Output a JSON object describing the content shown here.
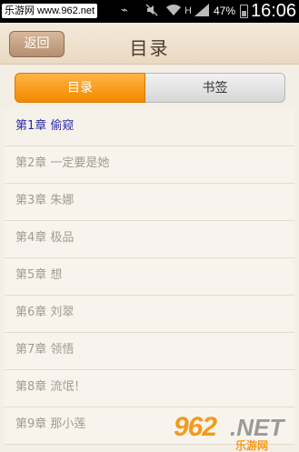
{
  "watermark_top": "乐游网 www.962.net",
  "status_bar": {
    "battery_text": "47%",
    "time": "16:06",
    "battery_level_percent": 47,
    "icons": [
      "usb-icon",
      "mute-icon",
      "wifi-icon",
      "h-signal-icon",
      "signal-bars-icon",
      "battery-icon"
    ]
  },
  "header": {
    "back_label": "返回",
    "title": "目录"
  },
  "tabs": [
    {
      "label": "目录",
      "selected": true
    },
    {
      "label": "书签",
      "selected": false
    }
  ],
  "chapters": [
    {
      "label": "第1章 偷窥",
      "active": true
    },
    {
      "label": "第2章 一定要是她",
      "active": false
    },
    {
      "label": "第3章 朱娜",
      "active": false
    },
    {
      "label": "第4章 极品",
      "active": false
    },
    {
      "label": "第5章 想",
      "active": false
    },
    {
      "label": "第6章 刘翠",
      "active": false
    },
    {
      "label": "第7章 领悟",
      "active": false
    },
    {
      "label": "第8章 流氓！",
      "active": false
    },
    {
      "label": "第9章 那小莲",
      "active": false
    }
  ],
  "watermark_bottom": {
    "number": "962",
    "suffix": ".NET",
    "sub": "乐游网"
  }
}
